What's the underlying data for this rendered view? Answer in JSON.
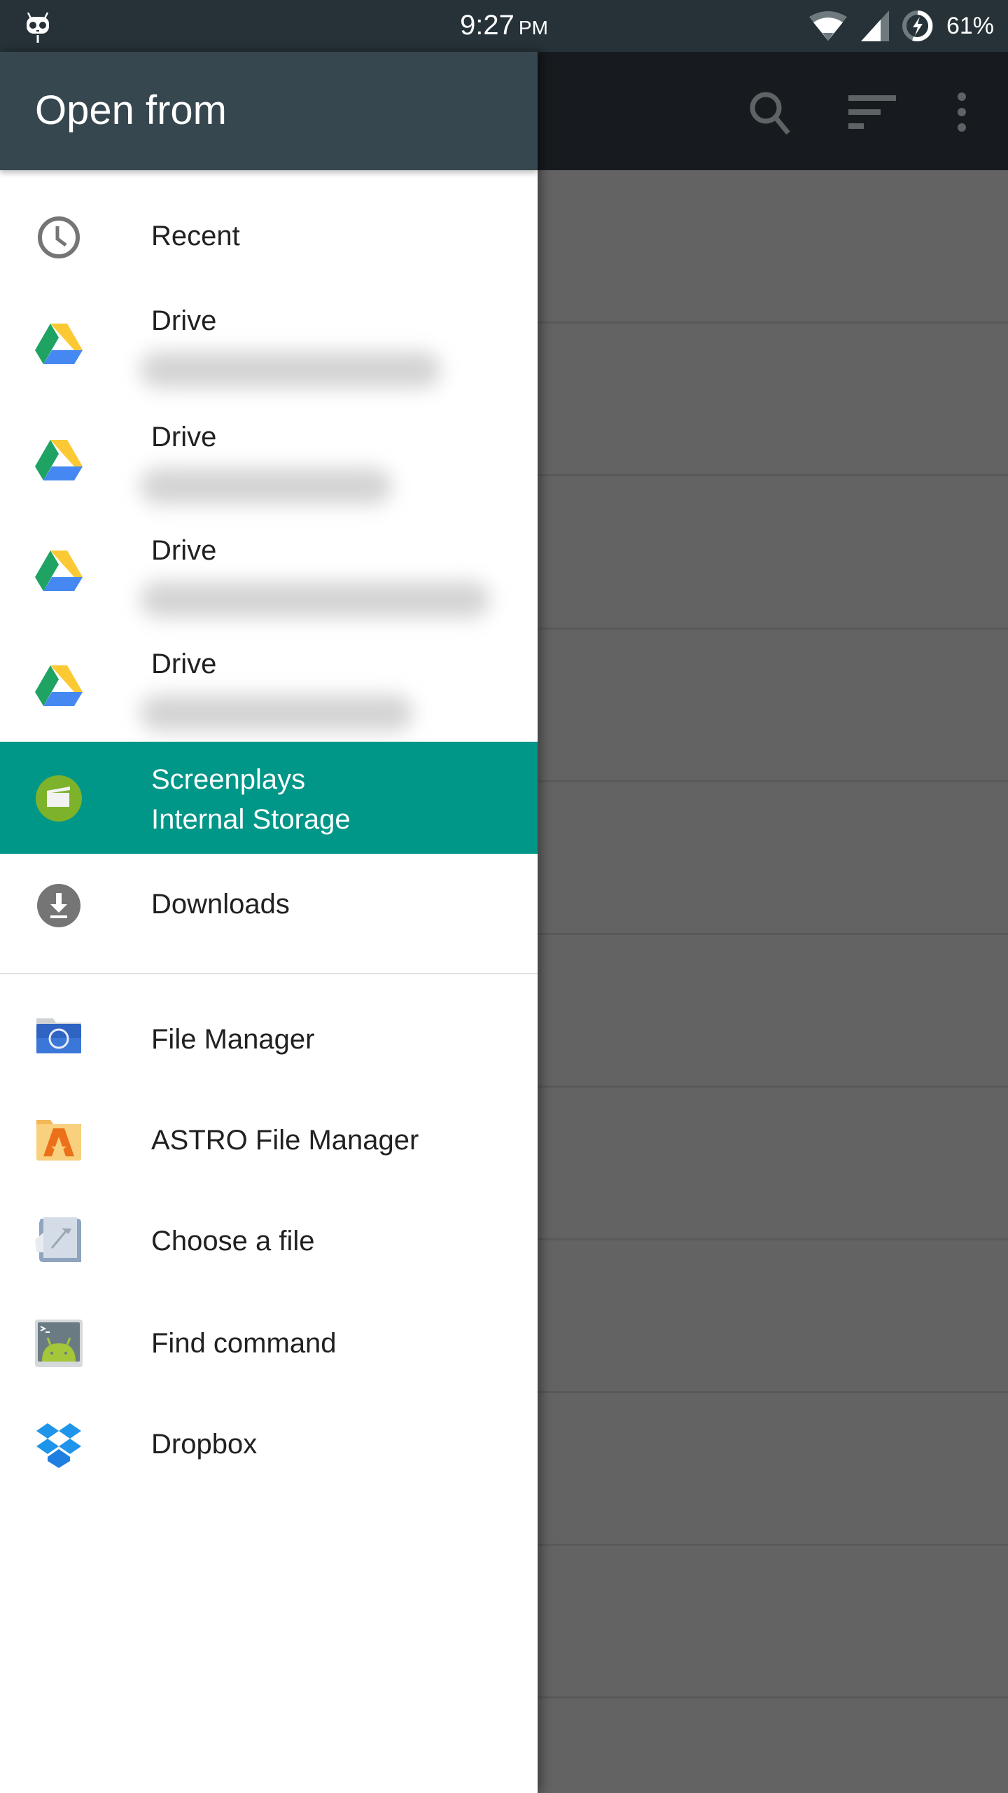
{
  "status_bar": {
    "time": "9:27",
    "ampm": "PM",
    "battery_percent": "61%",
    "icons": [
      "cyanogen-logo-icon",
      "wifi-icon",
      "cell-signal-icon",
      "battery-charging-icon"
    ]
  },
  "toolbar": {
    "icons": [
      "search-icon",
      "sort-icon",
      "more-vert-icon"
    ]
  },
  "drawer": {
    "title": "Open from",
    "roots": [
      {
        "label": "Recent",
        "icon": "clock-icon"
      },
      {
        "label": "Drive",
        "secondary": "(account hidden)",
        "icon": "google-drive-icon"
      },
      {
        "label": "Drive",
        "secondary": "(account hidden)",
        "icon": "google-drive-icon"
      },
      {
        "label": "Drive",
        "secondary": "(account hidden)",
        "icon": "google-drive-icon"
      },
      {
        "label": "Drive",
        "secondary": "(account hidden)",
        "icon": "google-drive-icon"
      },
      {
        "label": "Screenplays",
        "secondary": "Internal Storage",
        "icon": "screenplays-icon",
        "selected": true
      },
      {
        "label": "Downloads",
        "icon": "download-icon"
      }
    ],
    "apps": [
      {
        "label": "File Manager",
        "icon": "file-manager-icon"
      },
      {
        "label": "ASTRO File Manager",
        "icon": "astro-icon"
      },
      {
        "label": "Choose a file",
        "icon": "choose-file-icon"
      },
      {
        "label": "Find command",
        "icon": "terminal-android-icon"
      },
      {
        "label": "Dropbox",
        "icon": "dropbox-icon"
      }
    ]
  },
  "colors": {
    "status_bar": "#263238",
    "drawer_header": "#37474f",
    "selected_row": "#009688",
    "scrim": "#636363"
  }
}
